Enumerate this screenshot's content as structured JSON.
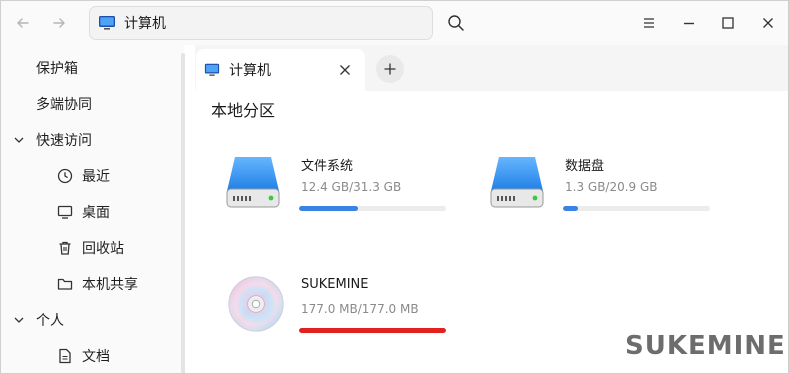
{
  "titlebar": {
    "address_text": "计算机",
    "icons": {
      "back": "arrow-left-icon",
      "forward": "arrow-right-icon",
      "search": "search-icon",
      "menu": "hamburger-menu-icon",
      "minimize": "minimize-icon",
      "maximize": "maximize-icon",
      "close": "close-icon"
    }
  },
  "sidebar": {
    "top_items": [
      {
        "label": "保护箱"
      },
      {
        "label": "多端协同"
      }
    ],
    "groups": [
      {
        "label": "快速访问",
        "expanded": true,
        "items": [
          {
            "label": "最近",
            "icon": "clock-icon"
          },
          {
            "label": "桌面",
            "icon": "desktop-icon"
          },
          {
            "label": "回收站",
            "icon": "trash-icon"
          },
          {
            "label": "本机共享",
            "icon": "folder-icon"
          }
        ]
      },
      {
        "label": "个人",
        "expanded": true,
        "items": [
          {
            "label": "文档",
            "icon": "document-icon"
          }
        ]
      }
    ]
  },
  "tabs": [
    {
      "label": "计算机",
      "active": true
    }
  ],
  "main": {
    "section_title": "本地分区",
    "drives": [
      {
        "name": "文件系统",
        "usage": "12.4 GB/31.3 GB",
        "fraction": 0.4,
        "bar_color": "#3a82e4",
        "icon": "hard-drive-icon"
      },
      {
        "name": "数据盘",
        "usage": "1.3 GB/20.9 GB",
        "fraction": 0.1,
        "bar_color": "#3a82e4",
        "icon": "hard-drive-icon"
      },
      {
        "name": "SUKEMINE",
        "usage": "177.0 MB/177.0 MB",
        "fraction": 1.0,
        "bar_color": "#e0211d",
        "icon": "optical-disc-icon"
      }
    ]
  },
  "watermark": "SUKEMINE"
}
